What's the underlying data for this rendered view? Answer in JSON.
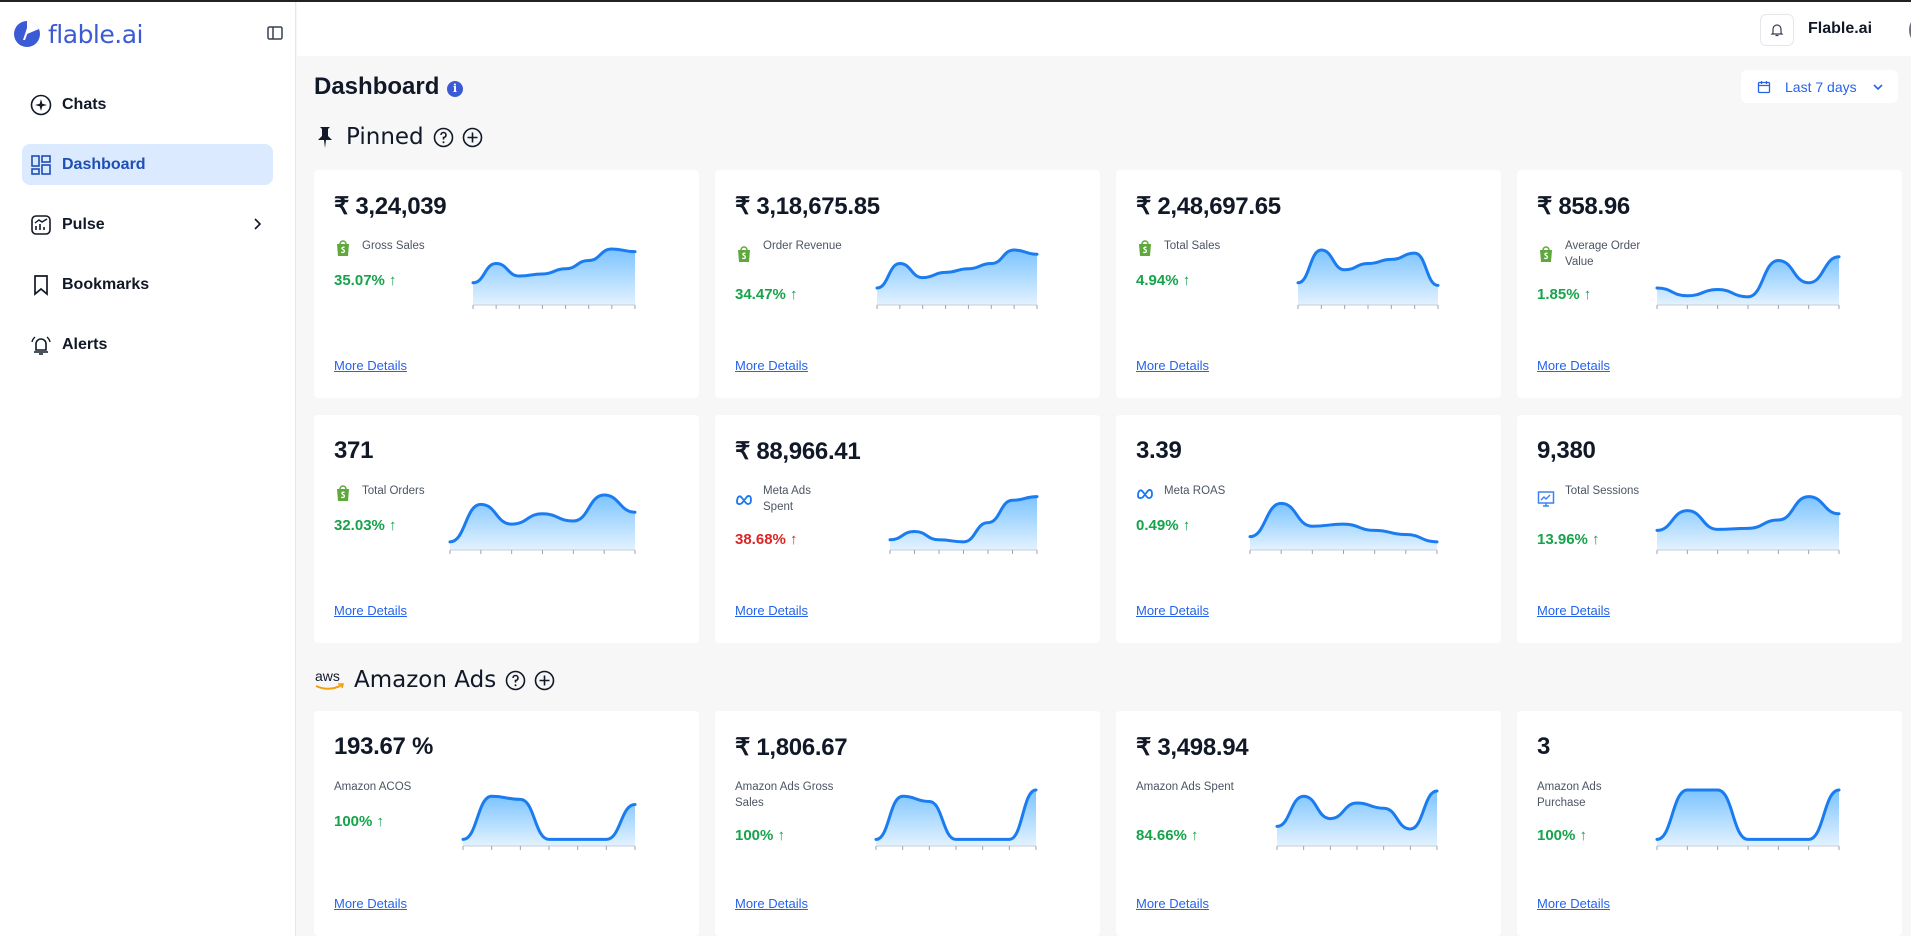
{
  "app": {
    "logo_text": "flable.ai",
    "user_name": "Flable.ai"
  },
  "sidebar": {
    "items": [
      {
        "label": "Chats",
        "icon": "sparkle-icon"
      },
      {
        "label": "Dashboard",
        "icon": "dashboard-grid-icon",
        "active": true
      },
      {
        "label": "Pulse",
        "icon": "pulse-chart-icon",
        "has_submenu": true
      },
      {
        "label": "Bookmarks",
        "icon": "bookmark-icon"
      },
      {
        "label": "Alerts",
        "icon": "alarm-bell-icon"
      }
    ]
  },
  "main": {
    "title": "Dashboard",
    "date_range": "Last 7 days",
    "sections": [
      {
        "title": "Pinned",
        "icon": "pin-icon"
      },
      {
        "title": "Amazon Ads",
        "icon": "aws-logo"
      }
    ]
  },
  "cards": [
    {
      "value": "₹ 3,24,039",
      "label": "Gross Sales",
      "source": "shopify",
      "change": "35.07% ↑",
      "trend": "up",
      "more": "More Details",
      "spark": [
        0.35,
        0.72,
        0.48,
        0.52,
        0.62,
        0.78,
        1.0,
        0.95
      ]
    },
    {
      "value": "₹ 3,18,675.85",
      "label": "Order Revenue",
      "source": "shopify",
      "change": "34.47% ↑",
      "trend": "up",
      "more": "More Details",
      "spark": [
        0.25,
        0.72,
        0.45,
        0.55,
        0.62,
        0.72,
        0.98,
        0.9
      ]
    },
    {
      "value": "₹ 2,48,697.65",
      "label": "Total Sales",
      "source": "shopify",
      "change": "4.94% ↑",
      "trend": "up",
      "more": "More Details",
      "spark": [
        0.35,
        0.98,
        0.6,
        0.72,
        0.8,
        0.92,
        0.3
      ]
    },
    {
      "value": "₹ 858.96",
      "label": "Average Order Value",
      "source": "shopify",
      "change": "1.85% ↑",
      "trend": "up",
      "more": "More Details",
      "spark": [
        0.25,
        0.1,
        0.22,
        0.08,
        0.78,
        0.35,
        0.85
      ]
    },
    {
      "value": "371",
      "label": "Total Orders",
      "source": "shopify",
      "change": "32.03% ↑",
      "trend": "up",
      "more": "More Details",
      "spark": [
        0.08,
        0.8,
        0.42,
        0.62,
        0.48,
        0.98,
        0.65
      ]
    },
    {
      "value": "₹ 88,966.41",
      "label": "Meta Ads Spent",
      "source": "meta",
      "change": "38.68% ↑",
      "trend": "down",
      "more": "More Details",
      "spark": [
        0.12,
        0.28,
        0.12,
        0.08,
        0.45,
        0.88,
        0.95
      ]
    },
    {
      "value": "3.39",
      "label": "Meta ROAS",
      "source": "meta",
      "change": "0.49% ↑",
      "trend": "up",
      "more": "More Details",
      "spark": [
        0.18,
        0.82,
        0.38,
        0.42,
        0.3,
        0.22,
        0.08
      ]
    },
    {
      "value": "9,380",
      "label": "Total Sessions",
      "source": "analytics",
      "change": "13.96% ↑",
      "trend": "up",
      "more": "More Details",
      "spark": [
        0.3,
        0.68,
        0.32,
        0.34,
        0.5,
        0.95,
        0.62
      ]
    },
    {
      "value": "193.67 %",
      "label": "Amazon ACOS",
      "source": "amazon",
      "change": "100% ↑",
      "trend": "up",
      "more": "More Details",
      "spark": [
        0.05,
        0.88,
        0.82,
        0.05,
        0.05,
        0.05,
        0.72
      ]
    },
    {
      "value": "₹ 1,806.67",
      "label": "Amazon Ads Gross Sales",
      "source": "amazon",
      "change": "100% ↑",
      "trend": "up",
      "more": "More Details",
      "spark": [
        0.05,
        0.88,
        0.78,
        0.05,
        0.05,
        0.05,
        1.0
      ]
    },
    {
      "value": "₹ 3,498.94",
      "label": "Amazon Ads Spent",
      "source": "amazon",
      "change": "84.66% ↑",
      "trend": "up",
      "more": "More Details",
      "spark": [
        0.3,
        0.88,
        0.45,
        0.75,
        0.65,
        0.25,
        0.98
      ]
    },
    {
      "value": "3",
      "label": "Amazon Ads Purchase",
      "source": "amazon",
      "change": "100% ↑",
      "trend": "up",
      "more": "More Details",
      "spark": [
        0.05,
        1.0,
        1.0,
        0.05,
        0.05,
        0.05,
        1.0
      ]
    }
  ],
  "colors": {
    "accent": "#3b5bd6",
    "positive": "#16a34a",
    "negative": "#dc2626",
    "spark_line": "#1a7cf0",
    "spark_fill": "#bfe1ff"
  }
}
